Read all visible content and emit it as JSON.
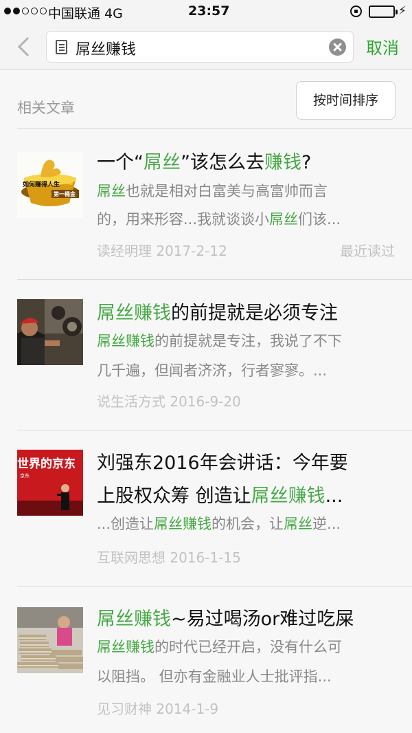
{
  "status_bar": {
    "carrier": "中国联通  4G",
    "time": "23:57"
  },
  "search": {
    "query": "屌丝赚钱",
    "cancel_label": "取消"
  },
  "section": {
    "title": "相关文章",
    "sort_label": "按时间排序"
  },
  "articles": [
    {
      "title": [
        "一个“",
        "屌丝",
        "”该怎么去",
        "赚钱",
        "?"
      ],
      "snippet1": [
        "屌丝",
        "也就是相对白富美与高富帅而言"
      ],
      "snippet2": [
        "的，用来形容...我就谈谈小",
        "屌丝",
        "们该..."
      ],
      "source_date": "读经明理 2017-2-12",
      "tag": "最近读过",
      "thumb_text": [
        "如何赚得人生",
        "第一桶金"
      ]
    },
    {
      "title": [
        "屌丝赚钱",
        "的前提就是必须专注"
      ],
      "snippet1": [
        "屌丝赚钱",
        "的前提就是专注，我说了不下"
      ],
      "snippet2": [
        "几千遍，但闻者济济，行者寥寥。..."
      ],
      "source_date": "说生活方式 2016-9-20"
    },
    {
      "title": [
        "刘强东2016年会讲话：今年要"
      ],
      "title2": [
        "上股权众筹 创造让",
        "屌丝赚钱",
        "..."
      ],
      "snippet1": [
        "...创造让",
        "屌丝赚钱",
        "的机会，让",
        "屌丝",
        "逆..."
      ],
      "source_date": "互联网思想 2016-1-15",
      "thumb_text": [
        "世界的京东",
        "京东"
      ]
    },
    {
      "title": [
        "屌丝赚钱",
        "~易过喝汤or难过吃屎"
      ],
      "snippet1": [
        "屌丝赚钱",
        "的时代已经开启，没有什么可"
      ],
      "snippet2": [
        "以阻挡。 但亦有金融业人士批评指..."
      ],
      "source_date": "见习财神 2014-1-9"
    }
  ],
  "colors": {
    "highlight": "#45a845",
    "cancel": "#2ea82c"
  }
}
